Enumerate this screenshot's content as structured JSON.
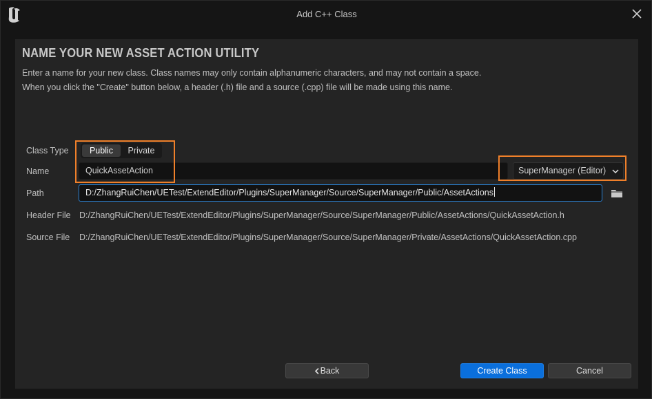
{
  "window": {
    "title": "Add C++ Class"
  },
  "header": {
    "heading": "NAME YOUR NEW ASSET ACTION UTILITY",
    "description_line1": "Enter a name for your new class. Class names may only contain alphanumeric characters, and may not contain a space.",
    "description_line2": "When you click the \"Create\" button below, a header (.h) file and a source (.cpp) file will be made using this name."
  },
  "form": {
    "class_type_label": "Class Type",
    "class_type_options": [
      "Public",
      "Private"
    ],
    "class_type_selected": "Public",
    "name_label": "Name",
    "name_value": "QuickAssetAction",
    "module_selected": "SuperManager (Editor)",
    "path_label": "Path",
    "path_value": "D:/ZhangRuiChen/UETest/ExtendEditor/Plugins/SuperManager/Source/SuperManager/Public/AssetActions",
    "header_file_label": "Header File",
    "header_file_value": "D:/ZhangRuiChen/UETest/ExtendEditor/Plugins/SuperManager/Source/SuperManager/Public/AssetActions/QuickAssetAction.h",
    "source_file_label": "Source File",
    "source_file_value": "D:/ZhangRuiChen/UETest/ExtendEditor/Plugins/SuperManager/Source/SuperManager/Private/AssetActions/QuickAssetAction.cpp"
  },
  "buttons": {
    "back": "Back",
    "create": "Create Class",
    "cancel": "Cancel"
  },
  "icons": {
    "logo": "unreal-engine-logo",
    "close": "close-icon",
    "folder": "folder-icon",
    "dropdown": "chevron-down-icon",
    "back": "chevron-left-icon"
  },
  "colors": {
    "accent": "#0a6fdc",
    "highlight": "#f0802a",
    "focus_border": "#2a84d8"
  }
}
